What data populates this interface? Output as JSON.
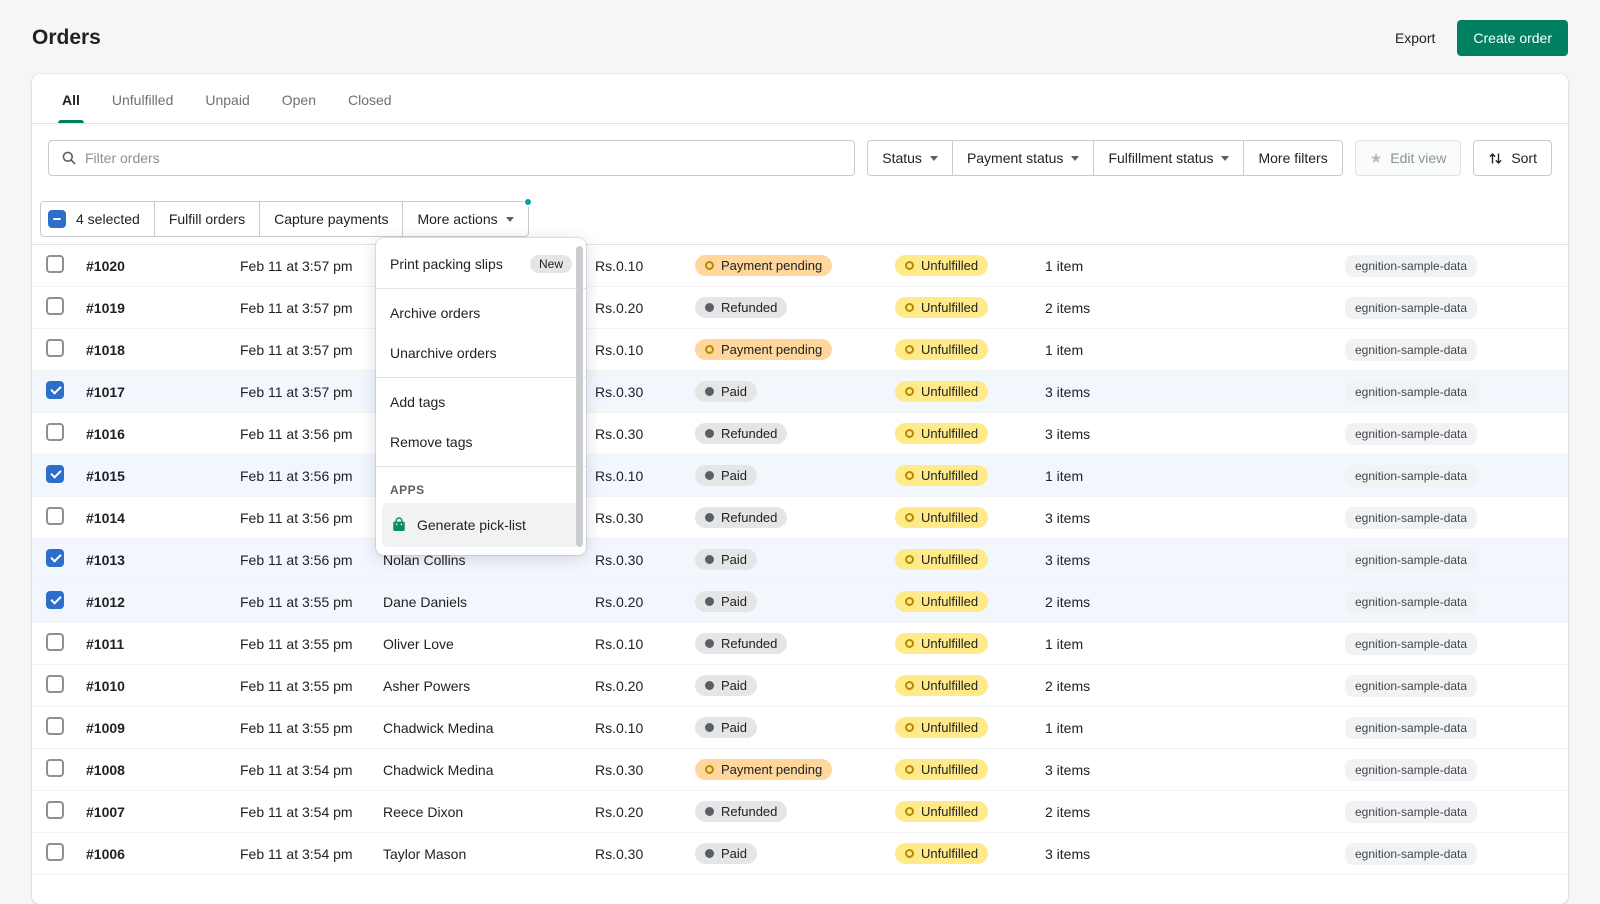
{
  "page": {
    "title": "Orders"
  },
  "header": {
    "export_label": "Export",
    "create_order_label": "Create order"
  },
  "tabs": [
    {
      "label": "All",
      "active": true
    },
    {
      "label": "Unfulfilled",
      "active": false
    },
    {
      "label": "Unpaid",
      "active": false
    },
    {
      "label": "Open",
      "active": false
    },
    {
      "label": "Closed",
      "active": false
    }
  ],
  "filters": {
    "search_placeholder": "Filter orders",
    "dropdowns": [
      {
        "label": "Status"
      },
      {
        "label": "Payment status"
      },
      {
        "label": "Fulfillment status"
      }
    ],
    "more_filters_label": "More filters",
    "edit_view_label": "Edit view",
    "sort_label": "Sort"
  },
  "bulk_bar": {
    "selected_label": "4 selected",
    "fulfill_label": "Fulfill orders",
    "capture_label": "Capture payments",
    "more_actions_label": "More actions"
  },
  "menu": {
    "sections": [
      {
        "items": [
          {
            "label": "Print packing slips",
            "badge": "New"
          }
        ]
      },
      {
        "items": [
          {
            "label": "Archive orders"
          },
          {
            "label": "Unarchive orders"
          }
        ]
      },
      {
        "items": [
          {
            "label": "Add tags"
          },
          {
            "label": "Remove tags"
          }
        ]
      },
      {
        "title": "APPS",
        "items": [
          {
            "label": "Generate pick-list",
            "icon": "pick-list-app-icon",
            "highlighted": true
          }
        ]
      }
    ]
  },
  "table": {
    "rows": [
      {
        "order": "#1020",
        "date": "Feb 11 at 3:57 pm",
        "customer": "",
        "total": "Rs.0.10",
        "payment": "Payment pending",
        "payment_tone": "warning",
        "fulfillment": "Unfulfilled",
        "items": "1 item",
        "tag": "egnition-sample-data",
        "selected": false
      },
      {
        "order": "#1019",
        "date": "Feb 11 at 3:57 pm",
        "customer": "",
        "total": "Rs.0.20",
        "payment": "Refunded",
        "payment_tone": "default",
        "fulfillment": "Unfulfilled",
        "items": "2 items",
        "tag": "egnition-sample-data",
        "selected": false
      },
      {
        "order": "#1018",
        "date": "Feb 11 at 3:57 pm",
        "customer": "",
        "total": "Rs.0.10",
        "payment": "Payment pending",
        "payment_tone": "warning",
        "fulfillment": "Unfulfilled",
        "items": "1 item",
        "tag": "egnition-sample-data",
        "selected": false
      },
      {
        "order": "#1017",
        "date": "Feb 11 at 3:57 pm",
        "customer": "",
        "total": "Rs.0.30",
        "payment": "Paid",
        "payment_tone": "default",
        "fulfillment": "Unfulfilled",
        "items": "3 items",
        "tag": "egnition-sample-data",
        "selected": true
      },
      {
        "order": "#1016",
        "date": "Feb 11 at 3:56 pm",
        "customer": "",
        "total": "Rs.0.30",
        "payment": "Refunded",
        "payment_tone": "default",
        "fulfillment": "Unfulfilled",
        "items": "3 items",
        "tag": "egnition-sample-data",
        "selected": false
      },
      {
        "order": "#1015",
        "date": "Feb 11 at 3:56 pm",
        "customer": "",
        "total": "Rs.0.10",
        "payment": "Paid",
        "payment_tone": "default",
        "fulfillment": "Unfulfilled",
        "items": "1 item",
        "tag": "egnition-sample-data",
        "selected": true
      },
      {
        "order": "#1014",
        "date": "Feb 11 at 3:56 pm",
        "customer": "",
        "total": "Rs.0.30",
        "payment": "Refunded",
        "payment_tone": "default",
        "fulfillment": "Unfulfilled",
        "items": "3 items",
        "tag": "egnition-sample-data",
        "selected": false
      },
      {
        "order": "#1013",
        "date": "Feb 11 at 3:56 pm",
        "customer": "Nolan Collins",
        "total": "Rs.0.30",
        "payment": "Paid",
        "payment_tone": "default",
        "fulfillment": "Unfulfilled",
        "items": "3 items",
        "tag": "egnition-sample-data",
        "selected": true
      },
      {
        "order": "#1012",
        "date": "Feb 11 at 3:55 pm",
        "customer": "Dane Daniels",
        "total": "Rs.0.20",
        "payment": "Paid",
        "payment_tone": "default",
        "fulfillment": "Unfulfilled",
        "items": "2 items",
        "tag": "egnition-sample-data",
        "selected": true
      },
      {
        "order": "#1011",
        "date": "Feb 11 at 3:55 pm",
        "customer": "Oliver Love",
        "total": "Rs.0.10",
        "payment": "Refunded",
        "payment_tone": "default",
        "fulfillment": "Unfulfilled",
        "items": "1 item",
        "tag": "egnition-sample-data",
        "selected": false
      },
      {
        "order": "#1010",
        "date": "Feb 11 at 3:55 pm",
        "customer": "Asher Powers",
        "total": "Rs.0.20",
        "payment": "Paid",
        "payment_tone": "default",
        "fulfillment": "Unfulfilled",
        "items": "2 items",
        "tag": "egnition-sample-data",
        "selected": false
      },
      {
        "order": "#1009",
        "date": "Feb 11 at 3:55 pm",
        "customer": "Chadwick Medina",
        "total": "Rs.0.10",
        "payment": "Paid",
        "payment_tone": "default",
        "fulfillment": "Unfulfilled",
        "items": "1 item",
        "tag": "egnition-sample-data",
        "selected": false
      },
      {
        "order": "#1008",
        "date": "Feb 11 at 3:54 pm",
        "customer": "Chadwick Medina",
        "total": "Rs.0.30",
        "payment": "Payment pending",
        "payment_tone": "warning",
        "fulfillment": "Unfulfilled",
        "items": "3 items",
        "tag": "egnition-sample-data",
        "selected": false
      },
      {
        "order": "#1007",
        "date": "Feb 11 at 3:54 pm",
        "customer": "Reece Dixon",
        "total": "Rs.0.20",
        "payment": "Refunded",
        "payment_tone": "default",
        "fulfillment": "Unfulfilled",
        "items": "2 items",
        "tag": "egnition-sample-data",
        "selected": false
      },
      {
        "order": "#1006",
        "date": "Feb 11 at 3:54 pm",
        "customer": "Taylor Mason",
        "total": "Rs.0.30",
        "payment": "Paid",
        "payment_tone": "default",
        "fulfillment": "Unfulfilled",
        "items": "3 items",
        "tag": "egnition-sample-data",
        "selected": false
      }
    ]
  },
  "colors": {
    "primary_green": "#008060",
    "interactive_blue": "#2c6ecb",
    "notification_teal": "#00a0ac",
    "warning_badge_bg": "#ffd79d",
    "attention_badge_bg": "#ffea8a",
    "neutral_badge_bg": "#e4e5e7",
    "selected_row_bg": "#f2f7fe"
  }
}
